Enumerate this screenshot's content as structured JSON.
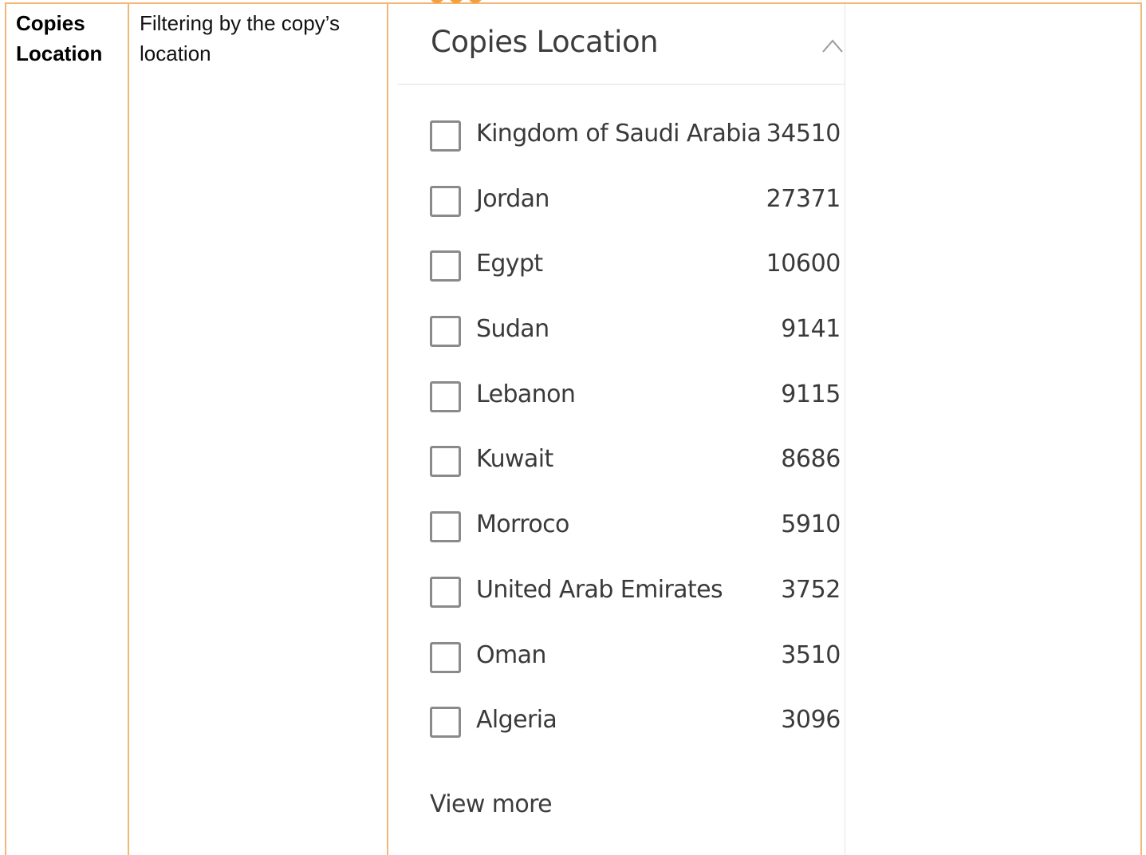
{
  "table": {
    "label": "Copies Location",
    "description": "Filtering by the copy’s location"
  },
  "panel": {
    "title": "Copies Location",
    "collapse_icon": "chevron-up-icon",
    "options": [
      {
        "label": "Kingdom of Saudi Arabia",
        "count": "34510",
        "checked": false
      },
      {
        "label": "Jordan",
        "count": "27371",
        "checked": false
      },
      {
        "label": "Egypt",
        "count": "10600",
        "checked": false
      },
      {
        "label": "Sudan",
        "count": "9141",
        "checked": false
      },
      {
        "label": "Lebanon",
        "count": "9115",
        "checked": false
      },
      {
        "label": "Kuwait",
        "count": "8686",
        "checked": false
      },
      {
        "label": "Morroco",
        "count": "5910",
        "checked": false
      },
      {
        "label": "United Arab Emirates",
        "count": "3752",
        "checked": false
      },
      {
        "label": "Oman",
        "count": "3510",
        "checked": false
      },
      {
        "label": "Algeria",
        "count": "3096",
        "checked": false
      }
    ],
    "view_more": "View more"
  },
  "colors": {
    "table_border": "#f2b676",
    "accent_dots": "#f5a03c",
    "text_dark": "#3a3a3a",
    "checkbox_border": "#8a8a8a"
  }
}
